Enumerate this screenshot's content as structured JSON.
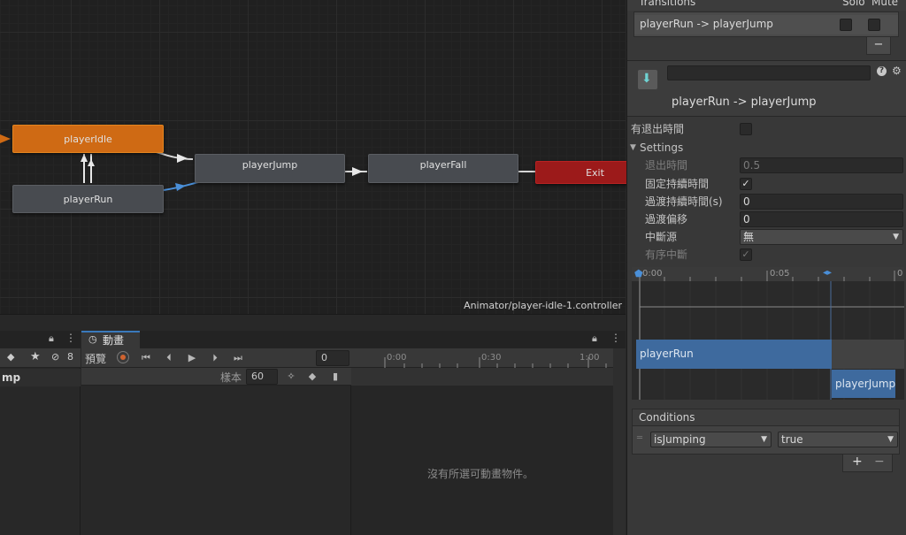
{
  "graph": {
    "nodes": {
      "idle": "playerIdle",
      "run": "playerRun",
      "jump": "playerJump",
      "fall": "playerFall",
      "exit": "Exit"
    },
    "path": "Animator/player-idle-1.controller"
  },
  "bottom": {
    "left_tab_text": "mp",
    "left_badge": "8",
    "anim_tab": "動畫",
    "preview_label": "預覽",
    "frame_value": "0",
    "sample_label": "樣本",
    "sample_value": "60",
    "ruler_ticks": [
      "0:00",
      "0:30",
      "1:00"
    ],
    "empty_message": "沒有所選可動畫物件。"
  },
  "inspector": {
    "transitions_header": "Transitions",
    "solo_label": "Solo",
    "mute_label": "Mute",
    "transition_item": "playerRun -> playerJump",
    "minus": "−",
    "title_field": "",
    "subtitle": "playerRun -> playerJump",
    "has_exit_time": "有退出時間",
    "settings": "Settings",
    "exit_time_label": "退出時間",
    "exit_time_value": "0.5",
    "fixed_duration_label": "固定持續時間",
    "transition_duration_label": "過渡持續時間(s)",
    "transition_duration_value": "0",
    "transition_offset_label": "過渡偏移",
    "transition_offset_value": "0",
    "interruption_label": "中斷源",
    "interruption_value": "無",
    "ordered_interruption_label": "有序中斷",
    "timeline_ticks": [
      "0:00",
      "0:05",
      "0"
    ],
    "timeline_from": "playerRun",
    "timeline_to": "playerJump",
    "conditions_header": "Conditions",
    "condition_param": "isJumping",
    "condition_value": "true",
    "plus": "+",
    "minus2": "−"
  },
  "colors": {
    "orange": "#cf6a14",
    "exit_red": "#9c1a1a",
    "blue": "#3e6a9e",
    "accent_blue": "#4a8fd8"
  }
}
